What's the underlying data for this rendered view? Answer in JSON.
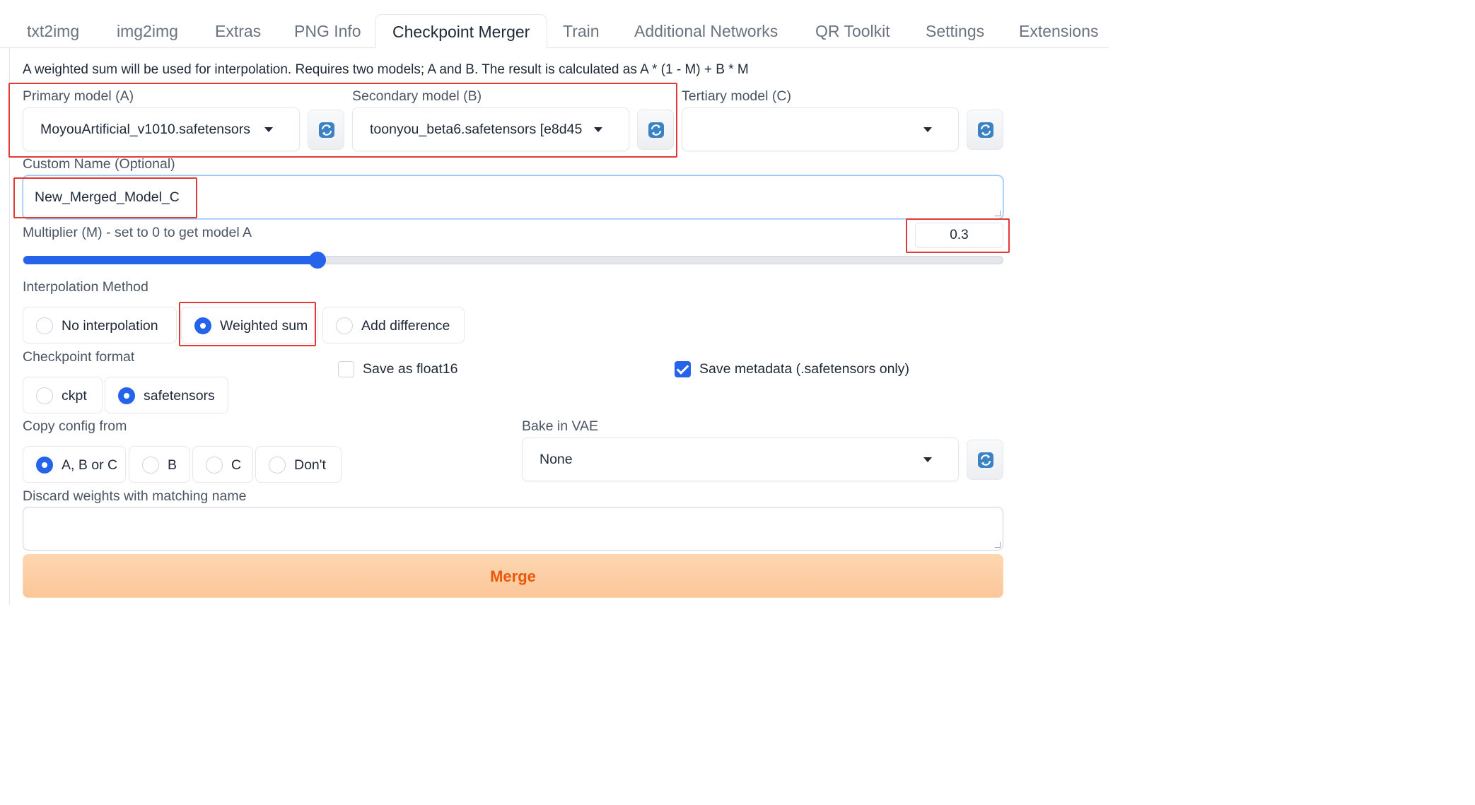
{
  "tabs": [
    {
      "label": "txt2img"
    },
    {
      "label": "img2img"
    },
    {
      "label": "Extras"
    },
    {
      "label": "PNG Info"
    },
    {
      "label": "Checkpoint Merger",
      "active": true
    },
    {
      "label": "Train"
    },
    {
      "label": "Additional Networks"
    },
    {
      "label": "QR Toolkit"
    },
    {
      "label": "Settings"
    },
    {
      "label": "Extensions"
    }
  ],
  "description": "A weighted sum will be used for interpolation. Requires two models; A and B. The result is calculated as A * (1 - M) + B * M",
  "models": {
    "primary": {
      "label": "Primary model (A)",
      "value": "MoyouArtificial_v1010.safetensors"
    },
    "secondary": {
      "label": "Secondary model (B)",
      "value": "toonyou_beta6.safetensors [e8d45"
    },
    "tertiary": {
      "label": "Tertiary model (C)",
      "value": ""
    }
  },
  "custom_name": {
    "label": "Custom Name (Optional)",
    "value": "New_Merged_Model_C"
  },
  "multiplier": {
    "label": "Multiplier (M) - set to 0 to get model A",
    "value": "0.3",
    "fraction": 0.3
  },
  "interpolation": {
    "label": "Interpolation Method",
    "options": [
      "No interpolation",
      "Weighted sum",
      "Add difference"
    ],
    "selected": "Weighted sum"
  },
  "checkpoint_format": {
    "label": "Checkpoint format",
    "options": [
      "ckpt",
      "safetensors"
    ],
    "selected": "safetensors"
  },
  "save_float16": {
    "label": "Save as float16",
    "checked": false
  },
  "save_metadata": {
    "label": "Save metadata (.safetensors only)",
    "checked": true
  },
  "copy_config": {
    "label": "Copy config from",
    "options": [
      "A, B or C",
      "B",
      "C",
      "Don't"
    ],
    "selected": "A, B or C"
  },
  "bake_vae": {
    "label": "Bake in VAE",
    "value": "None"
  },
  "discard_weights": {
    "label": "Discard weights with matching name",
    "value": ""
  },
  "merge_button": {
    "label": "Merge"
  },
  "colors": {
    "accent": "#2563eb",
    "merge_text": "#ea580c",
    "merge_bg": "#fcc69a",
    "highlight": "#e53935"
  }
}
